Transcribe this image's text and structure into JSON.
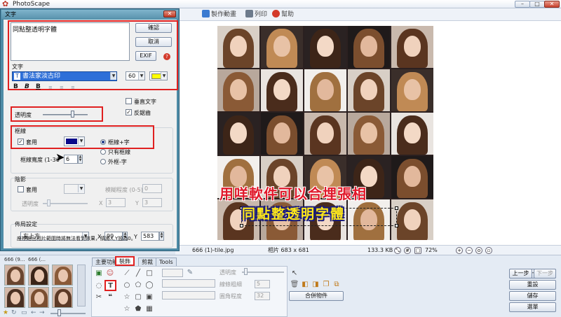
{
  "window": {
    "title": "PhotoScape",
    "min": "–",
    "max": "□",
    "close": "✕"
  },
  "topmenu": [
    {
      "label": "製作動畫",
      "icon": "animation-icon",
      "color": "#3b7bd1"
    },
    {
      "label": "列印",
      "icon": "printer-icon",
      "color": "#6d7b8c"
    },
    {
      "label": "幫助",
      "icon": "help-icon",
      "color": "#d33a2a"
    }
  ],
  "overlay": {
    "line1": "用咩軟件可以合埋張相",
    "line2": "同點整透明字體"
  },
  "status": {
    "filename": "666 (1)-tile.jpg",
    "photo_size": "相片 683 x 681",
    "filesize": "133.3 KB",
    "zoom": "72%"
  },
  "dialog": {
    "title": "文字",
    "close": "✕",
    "text_value": "同點整透明字體",
    "ok": "確認",
    "cancel": "取消",
    "exif": "EXIF",
    "help": "?",
    "text_section": "文字",
    "font": "書法家淡古印",
    "font_size": "60",
    "font_color": "#ffff00",
    "style_bold": "B",
    "style_italic": "B",
    "style_underline": "B",
    "vertical_text": "垂直文字",
    "antialias": "反鋸齒",
    "opacity": "透明度",
    "opacity_value": 0.65,
    "border_section": "框線",
    "border_apply": "套用",
    "border_color": "#0a0a8a",
    "border_opt1": "框線+字",
    "border_opt2": "只有框線",
    "border_opt3": "外框-字",
    "border_width_label": "框線寬度 (1-36",
    "border_width": "6",
    "shadow_section": "陰影",
    "shadow_apply": "套用",
    "shadow_blur": "模糊程度 (0-5)",
    "shadow_blur_value": "0",
    "shadow_opacity": "透明度",
    "shadow_x_label": "X",
    "shadow_x": "3",
    "shadow_y_label": "Y",
    "shadow_y": "3",
    "layout_section": "佈局設定",
    "layout_anchor": "左上方",
    "x_label": "X",
    "x_value": "99",
    "y_label": "Y",
    "y_value": "583",
    "note": "座標超出相片範圍時將無法看到效果，請將X,Y設為0。"
  },
  "thumbs": [
    {
      "caption": "666 (9..."
    },
    {
      "caption": "666 (..."
    }
  ],
  "tabs": [
    "主要功能",
    "裝飾",
    "剪裁",
    "Tools"
  ],
  "tools": {
    "opacity": "透明度",
    "line_width": "線條粗細",
    "line_width_value": "5",
    "roundness": "圓角程度",
    "roundness_value": "32",
    "merge": "合併物件"
  },
  "right_buttons": {
    "undo": "上一步",
    "redo": "下一步",
    "restore": "重設",
    "save": "儲存",
    "menu": "選單"
  }
}
